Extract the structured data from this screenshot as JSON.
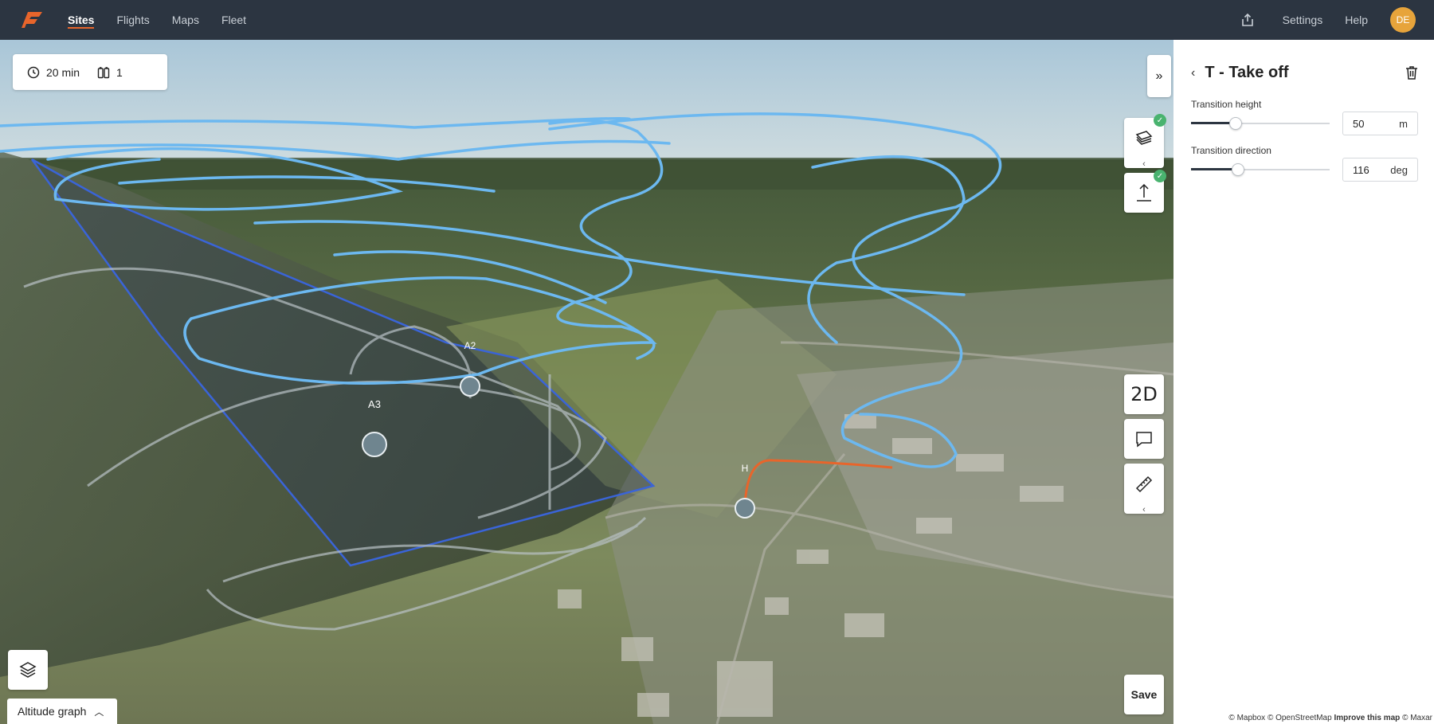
{
  "nav": {
    "logo_icon": "brand-logo-icon",
    "items": [
      "Sites",
      "Flights",
      "Maps",
      "Fleet"
    ],
    "active": "Sites",
    "share_icon": "share-icon",
    "settings": "Settings",
    "help": "Help",
    "avatar": "DE"
  },
  "mission_info": {
    "duration": "20 min",
    "batteries": "1",
    "clock_icon": "clock-icon",
    "battery_icon": "battery-icon"
  },
  "map": {
    "waypoints": [
      "A2",
      "A3",
      "H"
    ],
    "view_mode": "2D",
    "save": "Save",
    "altitude_graph": "Altitude graph",
    "attribution": {
      "mapbox": "© Mapbox",
      "osm": "© OpenStreetMap",
      "improve": "Improve this map",
      "maxar": "© Maxar"
    },
    "colors": {
      "flight_path": "#6cb8f0",
      "takeoff_path": "#e8652b",
      "area_border": "#3a64d8"
    }
  },
  "panel": {
    "title": "T - Take off",
    "transition_height": {
      "label": "Transition height",
      "value": "50",
      "unit": "m",
      "slider_fraction": 0.32
    },
    "transition_direction": {
      "label": "Transition direction",
      "value": "116",
      "unit": "deg",
      "slider_fraction": 0.34
    }
  }
}
